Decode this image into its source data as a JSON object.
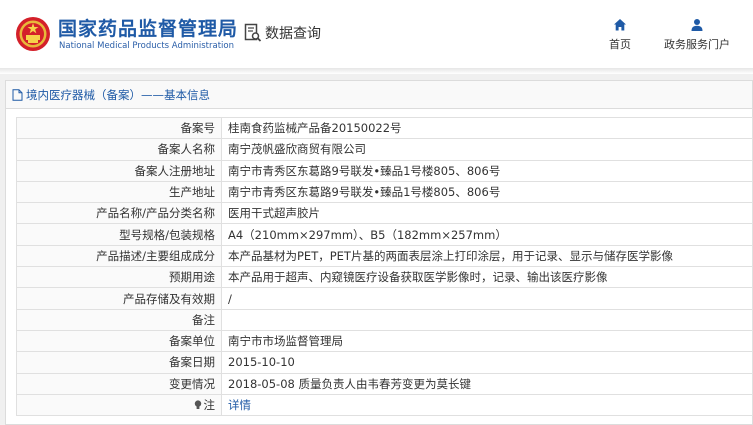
{
  "header": {
    "title_cn": "国家药品监督管理局",
    "title_en": "National Medical Products Administration",
    "query_label": "数据查询",
    "nav": [
      {
        "label": "首页",
        "icon": "home-icon"
      },
      {
        "label": "政务服务门户",
        "icon": "user-icon"
      }
    ]
  },
  "panel": {
    "title": "境内医疗器械（备案）——基本信息"
  },
  "rows": [
    {
      "label": "备案号",
      "value": "桂南食药监械产品备20150022号"
    },
    {
      "label": "备案人名称",
      "value": "南宁茂帆盛欣商贸有限公司"
    },
    {
      "label": "备案人注册地址",
      "value": "南宁市青秀区东葛路9号联发•臻品1号楼805、806号"
    },
    {
      "label": "生产地址",
      "value": "南宁市青秀区东葛路9号联发•臻品1号楼805、806号"
    },
    {
      "label": "产品名称/产品分类名称",
      "value": "医用干式超声胶片"
    },
    {
      "label": "型号规格/包装规格",
      "value": "A4（210mm×297mm）、B5（182mm×257mm）"
    },
    {
      "label": "产品描述/主要组成成分",
      "value": "本产品基材为PET，PET片基的两面表层涂上打印涂层，用于记录、显示与储存医学影像"
    },
    {
      "label": "预期用途",
      "value": "本产品用于超声、内窥镜医疗设备获取医学影像时，记录、输出该医疗影像"
    },
    {
      "label": "产品存储及有效期",
      "value": "/"
    },
    {
      "label": "备注",
      "value": ""
    },
    {
      "label": "备案单位",
      "value": "南宁市市场监督管理局"
    },
    {
      "label": "备案日期",
      "value": "2015-10-10"
    },
    {
      "label": "变更情况",
      "value": "2018-05-08 质量负责人由韦春芳变更为莫长键"
    }
  ],
  "note_row": {
    "label": "注",
    "link": "详情",
    "icon": "bulb-icon"
  },
  "colors": {
    "brand": "#1f5aa6",
    "border": "#e0e0e0",
    "gray_bg": "#f0f0f0"
  }
}
